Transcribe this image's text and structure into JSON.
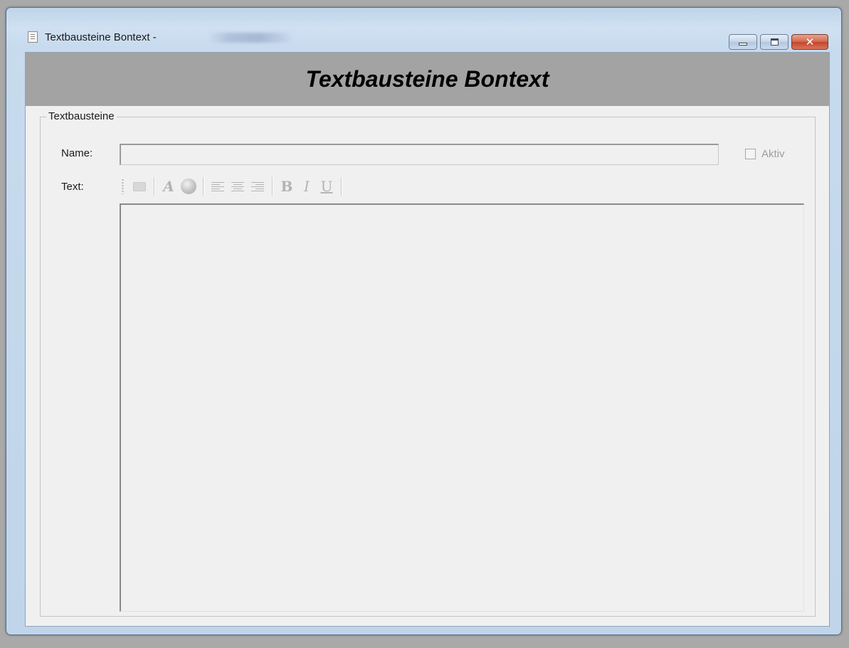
{
  "window": {
    "title": "Textbausteine Bontext -",
    "title_obscured": true,
    "buttons": {
      "minimize_icon": "minimize-icon",
      "maximize_icon": "restore-icon",
      "close_icon": "close-icon",
      "close_glyph": "✕"
    },
    "app_icon": "document-icon"
  },
  "header": {
    "title": "Textbausteine Bontext",
    "background": "#a3a3a3"
  },
  "form": {
    "group_label": "Textbausteine",
    "name_label": "Name:",
    "name_value": "",
    "aktiv_label": "Aktiv",
    "aktiv_checked": false,
    "text_label": "Text:",
    "text_value": ""
  },
  "toolbar": {
    "items": [
      {
        "name": "open-folder-icon"
      },
      {
        "name": "font-icon",
        "glyph": "A"
      },
      {
        "name": "color-globe-icon"
      },
      {
        "name": "align-left-icon"
      },
      {
        "name": "align-center-icon"
      },
      {
        "name": "align-right-icon"
      },
      {
        "name": "bold-icon",
        "glyph": "B"
      },
      {
        "name": "italic-icon",
        "glyph": "I"
      },
      {
        "name": "underline-icon",
        "glyph": "U"
      }
    ],
    "enabled": false
  }
}
